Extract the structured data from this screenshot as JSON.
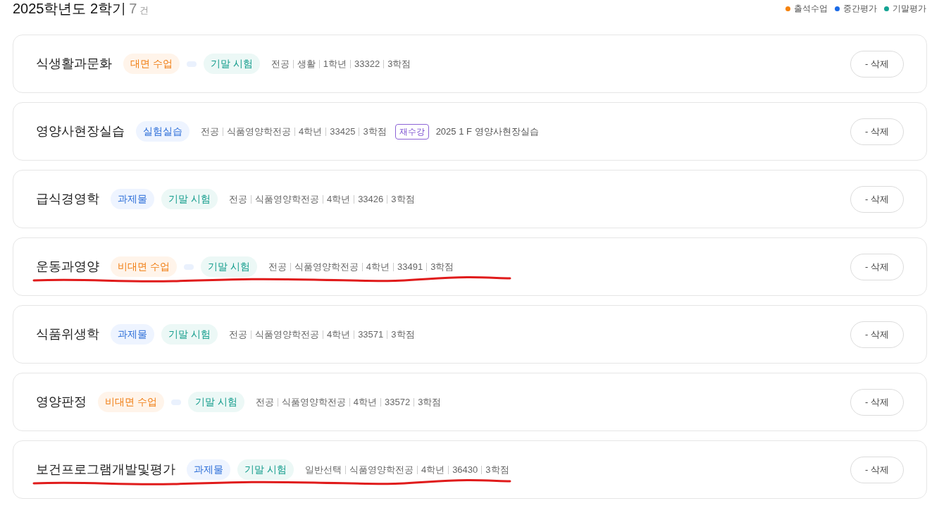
{
  "header": {
    "title": "2025학년도 2학기",
    "count": "7",
    "count_unit": "건"
  },
  "legend": [
    {
      "label": "출석수업",
      "color": "#f5820d"
    },
    {
      "label": "중간평가",
      "color": "#1b6ae6"
    },
    {
      "label": "기말평가",
      "color": "#14a393"
    }
  ],
  "courses": [
    {
      "name": "식생활과문화",
      "tags": [
        {
          "kind": "orange",
          "label": "대면 수업"
        },
        {
          "kind": "blank"
        },
        {
          "kind": "teal",
          "label": "기말 시험"
        }
      ],
      "meta": [
        "전공",
        "생활",
        "1학년",
        "33322",
        "3학점"
      ],
      "button": "- 삭제",
      "underlined": false
    },
    {
      "name": "영양사현장실습",
      "tags": [
        {
          "kind": "blue",
          "label": "실험실습"
        }
      ],
      "meta": [
        "전공",
        "식품영양학전공",
        "4학년",
        "33425",
        "3학점"
      ],
      "retake": {
        "label": "재수강",
        "note": "2025 1 F 영양사현장실습"
      },
      "button": "- 삭제",
      "underlined": false
    },
    {
      "name": "급식경영학",
      "tags": [
        {
          "kind": "blue",
          "label": "과제물"
        },
        {
          "kind": "teal",
          "label": "기말 시험"
        }
      ],
      "meta": [
        "전공",
        "식품영양학전공",
        "4학년",
        "33426",
        "3학점"
      ],
      "button": "- 삭제",
      "underlined": false
    },
    {
      "name": "운동과영양",
      "tags": [
        {
          "kind": "orange",
          "label": "비대면 수업"
        },
        {
          "kind": "blank"
        },
        {
          "kind": "teal",
          "label": "기말 시험"
        }
      ],
      "meta": [
        "전공",
        "식품영양학전공",
        "4학년",
        "33491",
        "3학점"
      ],
      "button": "- 삭제",
      "underlined": true
    },
    {
      "name": "식품위생학",
      "tags": [
        {
          "kind": "blue",
          "label": "과제물"
        },
        {
          "kind": "teal",
          "label": "기말 시험"
        }
      ],
      "meta": [
        "전공",
        "식품영양학전공",
        "4학년",
        "33571",
        "3학점"
      ],
      "button": "- 삭제",
      "underlined": false
    },
    {
      "name": "영양판정",
      "tags": [
        {
          "kind": "orange",
          "label": "비대면 수업"
        },
        {
          "kind": "blank"
        },
        {
          "kind": "teal",
          "label": "기말 시험"
        }
      ],
      "meta": [
        "전공",
        "식품영양학전공",
        "4학년",
        "33572",
        "3학점"
      ],
      "button": "- 삭제",
      "underlined": false
    },
    {
      "name": "보건프로그램개발및평가",
      "tags": [
        {
          "kind": "blue",
          "label": "과제물"
        },
        {
          "kind": "teal",
          "label": "기말 시험"
        }
      ],
      "meta": [
        "일반선택",
        "식품영양학전공",
        "4학년",
        "36430",
        "3학점"
      ],
      "button": "- 삭제",
      "underlined": true
    }
  ]
}
